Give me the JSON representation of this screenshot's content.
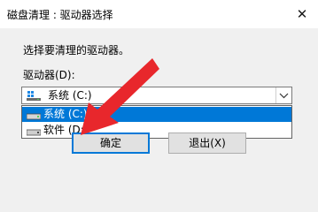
{
  "window": {
    "title": "磁盘清理 : 驱动器选择",
    "close_glyph": "✕"
  },
  "dialog": {
    "prompt": "选择要清理的驱动器。",
    "drives_label": "驱动器(D):"
  },
  "combo": {
    "selected": "系统 (C:)",
    "icon": "windows-drive-icon"
  },
  "dropdown": {
    "options": [
      {
        "label": "系统 (C:)",
        "icon": "drive-icon",
        "selected": true
      },
      {
        "label": "软件 (D:)",
        "icon": "drive-icon",
        "selected": false
      }
    ]
  },
  "buttons": {
    "ok": "确定",
    "exit": "退出(X)"
  },
  "annotation": {
    "arrow_color": "#e8272c"
  },
  "colors": {
    "selection": "#0078d7",
    "accent": "#0078d7"
  }
}
